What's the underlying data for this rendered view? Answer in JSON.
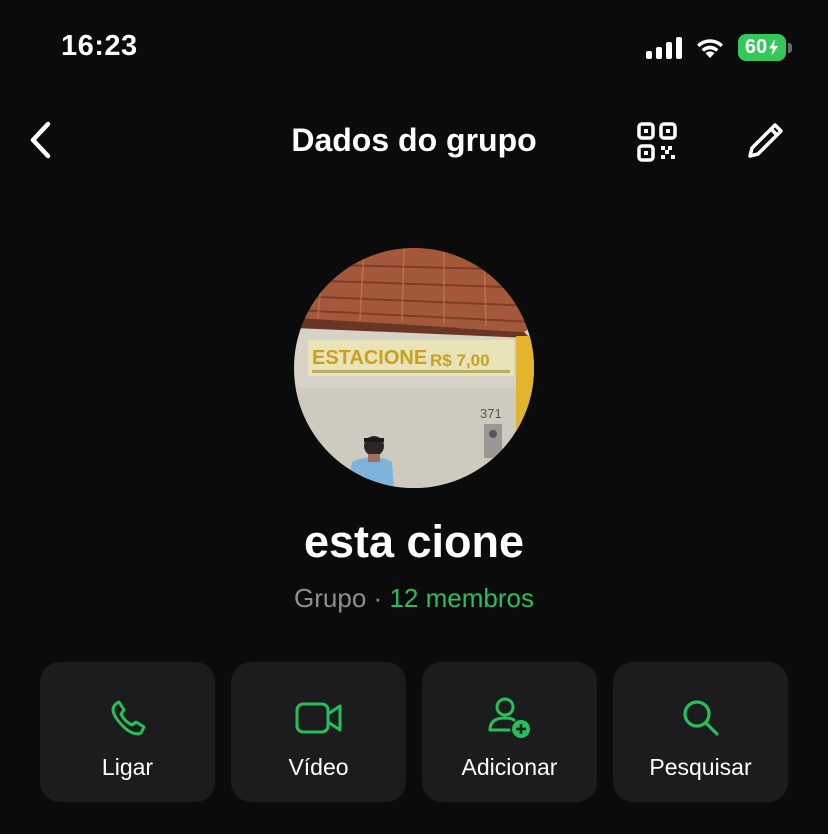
{
  "status_bar": {
    "time": "16:23",
    "battery_level": "60",
    "battery_charging": true,
    "signal_bars": 4,
    "icons": [
      "signal-icon",
      "wifi-icon",
      "battery-icon"
    ]
  },
  "nav": {
    "back_icon": "chevron-left-icon",
    "title": "Dados do grupo",
    "qr_icon": "qr-code-icon",
    "edit_icon": "pencil-icon"
  },
  "group": {
    "name": "esta cione",
    "type_label": "Grupo",
    "separator": "·",
    "members_label": "12 membros",
    "photo_sign_text": "ESTACIONE",
    "photo_price_text": "R$ 7,00",
    "photo_number_text": "371"
  },
  "actions": [
    {
      "label": "Ligar",
      "icon": "phone-icon"
    },
    {
      "label": "Vídeo",
      "icon": "video-camera-icon"
    },
    {
      "label": "Adicionar",
      "icon": "add-person-icon"
    },
    {
      "label": "Pesquisar",
      "icon": "search-icon"
    }
  ],
  "colors": {
    "background": "#0b0b0b",
    "card": "#1c1c1e",
    "accent": "#25c05a",
    "secondary_text": "#8e8e93",
    "battery": "#34c759"
  }
}
